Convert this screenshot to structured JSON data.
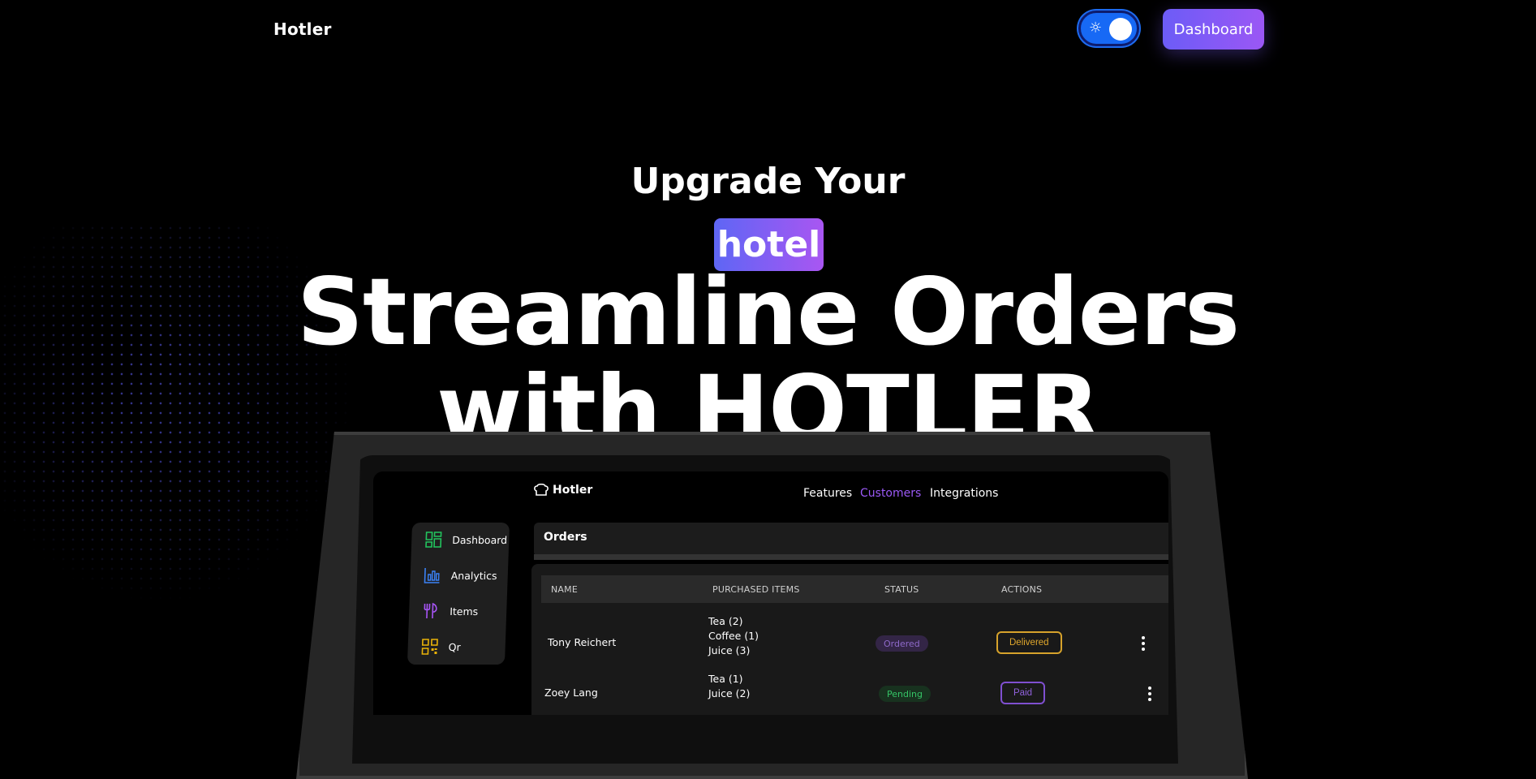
{
  "header": {
    "brand": "Hotler",
    "theme_toggle_icon": "sun-icon",
    "dashboard_button": "Dashboard"
  },
  "hero": {
    "line1": "Upgrade Your",
    "highlight": "hotel",
    "title_line1": "Streamline Orders",
    "title_line2": "with HOTLER"
  },
  "colors": {
    "accent_gradient_start": "#6c5cf6",
    "accent_gradient_end": "#9b57f5",
    "toggle_blue": "#1769f5"
  },
  "mockup": {
    "brand": "Hotler",
    "nav": [
      "Features",
      "Customers",
      "Integrations"
    ],
    "nav_active": "Customers",
    "sidebar": [
      {
        "label": "Dashboard",
        "icon": "dashboard-grid-icon"
      },
      {
        "label": "Analytics",
        "icon": "analytics-chart-icon"
      },
      {
        "label": "Items",
        "icon": "fork-knife-icon"
      },
      {
        "label": "Qr",
        "icon": "qr-code-icon"
      }
    ],
    "orders_title": "Orders",
    "table": {
      "headers": [
        "NAME",
        "PURCHASED ITEMS",
        "STATUS",
        "ACTIONS"
      ],
      "rows": [
        {
          "name": "Tony Reichert",
          "items": [
            "Tea (2)",
            "Coffee (1)",
            "Juice (3)"
          ],
          "status": "Ordered",
          "action": "Delivered"
        },
        {
          "name": "Zoey Lang",
          "items": [
            "Tea (1)",
            "Juice (2)"
          ],
          "status": "Pending",
          "action": "Paid"
        }
      ]
    }
  }
}
